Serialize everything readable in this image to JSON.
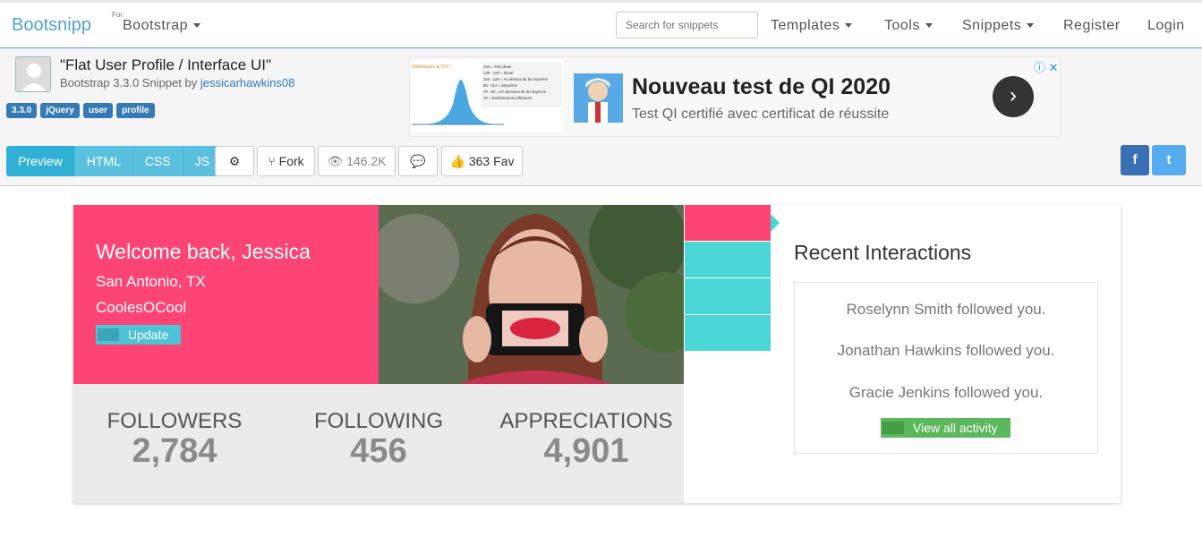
{
  "nav": {
    "brand": "Bootsnipp",
    "for_label": "For",
    "framework": "Bootstrap",
    "search_placeholder": "Search for snippets",
    "links": [
      "Templates",
      "Tools",
      "Snippets",
      "Register",
      "Login"
    ]
  },
  "snippet": {
    "title": "\"Flat User Profile / Interface UI\"",
    "subtitle_prefix": "Bootstrap 3.3.0 Snippet by",
    "author": "jessicarhawkins08",
    "tags": [
      "3.3.0",
      "jQuery",
      "user",
      "profile"
    ]
  },
  "ad": {
    "title": "Nouveau test de QI 2020",
    "subtitle": "Test QI certifié avec certificat de réussite",
    "graph_title": "Statistiques qi 2017",
    "graph_legend": [
      "144 = Très doué",
      "130 - 144 = Doué",
      "115 - 129 = Au dessus de la moyenne",
      "85 - 114 = Moyenne",
      "70 - 84 = En dessous de la moyenne",
      "70 = Extrêmement inférieure"
    ]
  },
  "toolbar": {
    "tabs": [
      "Preview",
      "HTML",
      "CSS",
      "JS"
    ],
    "fork": "Fork",
    "views": "146.2K",
    "fav": "363 Fav",
    "facebook": "f",
    "twitter": "t"
  },
  "profile": {
    "welcome": "Welcome back, Jessica",
    "location": "San Antonio, TX",
    "username": "CoolesOCool",
    "update_label": "Update",
    "stats": [
      {
        "label": "FOLLOWERS",
        "value": "2,784"
      },
      {
        "label": "FOLLOWING",
        "value": "456"
      },
      {
        "label": "APPRECIATIONS",
        "value": "4,901"
      }
    ]
  },
  "recent": {
    "title": "Recent Interactions",
    "items": [
      "Roselynn Smith followed you.",
      "Jonathan Hawkins followed you.",
      "Gracie Jenkins followed you."
    ],
    "button_label": "View all activity"
  }
}
